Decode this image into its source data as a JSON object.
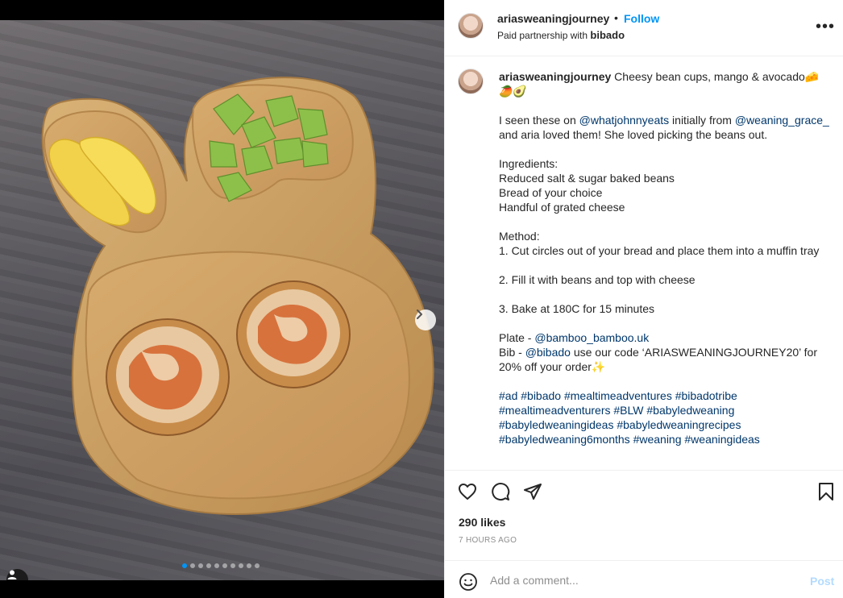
{
  "post": {
    "username": "ariasweaningjourney",
    "follow_label": "Follow",
    "separator": "•",
    "partnership_prefix": "Paid partnership with",
    "partner_name": "bibado",
    "more_label": "•••"
  },
  "caption": {
    "username": "ariasweaningjourney",
    "title": "Cheesy bean cups, mango & avocado",
    "title_emoji": "🧀🥭🥑",
    "intro_1": "I seen these on ",
    "mention_1": "@whatjohnnyeats",
    "intro_2": " initially from ",
    "mention_2": "@weaning_grace_",
    "intro_3": " and aria loved them! She loved picking the beans out.",
    "ingredients_heading": "Ingredients:",
    "ingredients": [
      "Reduced salt & sugar baked beans",
      "Bread of your choice",
      "Handful of grated cheese"
    ],
    "method_heading": "Method:",
    "step_1": "1. Cut circles out of your bread and place them into a muffin tray",
    "step_2": "2. Fill it with beans and top with cheese",
    "step_3": "3. Bake at 180C for 15 minutes",
    "plate_prefix": "Plate - ",
    "plate_mention": "@bamboo_bamboo.uk",
    "bib_prefix": "Bib - ",
    "bib_mention": "@bibado",
    "bib_text": " use our code ‘ARIASWEANINGJOURNEY20’ for 20% off your order✨",
    "hashtags": "#ad #bibado #mealtimeadventures #bibadotribe #mealtimeadventurers #BLW #babyledweaning #babyledweaningideas #babyledweaningrecipes #babyledweaning6months #weaning #weaningideas"
  },
  "stats": {
    "likes": "290 likes",
    "time": "7 HOURS AGO"
  },
  "comment": {
    "placeholder": "Add a comment...",
    "post_label": "Post"
  },
  "carousel": {
    "count": 10,
    "active": 0
  },
  "colors": {
    "accent": "#0095f6",
    "link": "#00376b",
    "muted": "#8e8e8e",
    "post_disabled": "#b3dbff"
  },
  "icons": [
    "heart-icon",
    "comment-icon",
    "share-icon",
    "bookmark-icon",
    "emoji-icon",
    "chevron-right-icon",
    "user-tag-icon",
    "more-icon"
  ]
}
